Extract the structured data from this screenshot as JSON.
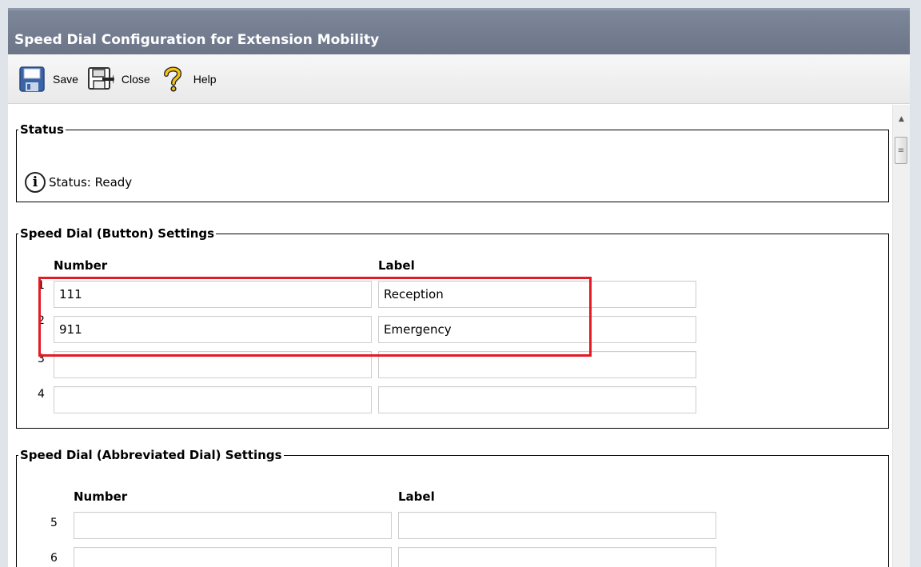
{
  "window": {
    "title": "Speed Dial Configuration for Extension Mobility"
  },
  "toolbar": {
    "save_label": "Save",
    "close_label": "Close",
    "help_label": "Help"
  },
  "status": {
    "legend": "Status",
    "text": "Status: Ready"
  },
  "button_settings": {
    "legend": "Speed Dial (Button) Settings",
    "number_header": "Number",
    "label_header": "Label",
    "rows": [
      {
        "index": "1",
        "number": "111",
        "label": "Reception"
      },
      {
        "index": "2",
        "number": "911",
        "label": "Emergency"
      },
      {
        "index": "3",
        "number": "",
        "label": ""
      },
      {
        "index": "4",
        "number": "",
        "label": ""
      }
    ]
  },
  "abbreviated_settings": {
    "legend": "Speed Dial (Abbreviated Dial) Settings",
    "number_header": "Number",
    "label_header": "Label",
    "rows": [
      {
        "index": "5",
        "number": "",
        "label": ""
      },
      {
        "index": "6",
        "number": "",
        "label": ""
      }
    ]
  },
  "colors": {
    "titlebar": "#6f788b",
    "highlight": "#e21b24"
  }
}
